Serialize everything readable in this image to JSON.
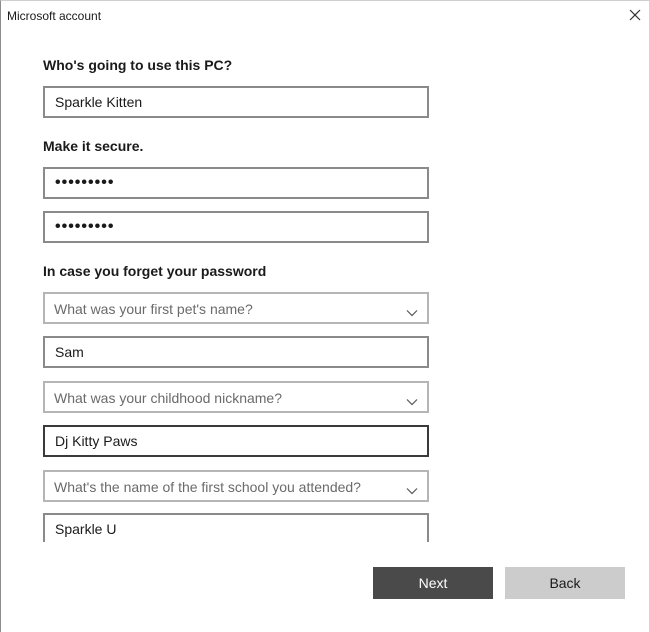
{
  "window": {
    "title": "Microsoft account",
    "close_icon": "close-icon"
  },
  "form": {
    "user_heading": "Who's going to use this PC?",
    "username_value": "Sparkle Kitten",
    "secure_heading": "Make it secure.",
    "password_value": "•••••••••",
    "confirm_password_value": "•••••••••",
    "recovery_heading": "In case you forget your password",
    "questions": [
      {
        "question": "What was your first pet's name?",
        "answer": "Sam"
      },
      {
        "question": "What was your childhood nickname?",
        "answer": "Dj Kitty Paws"
      },
      {
        "question": "What's the name of the first school you attended?",
        "answer": "Sparkle U"
      }
    ]
  },
  "buttons": {
    "next_label": "Next",
    "back_label": "Back"
  },
  "colors": {
    "primary_button": "#4a4a4a",
    "secondary_button": "#cccccc"
  }
}
